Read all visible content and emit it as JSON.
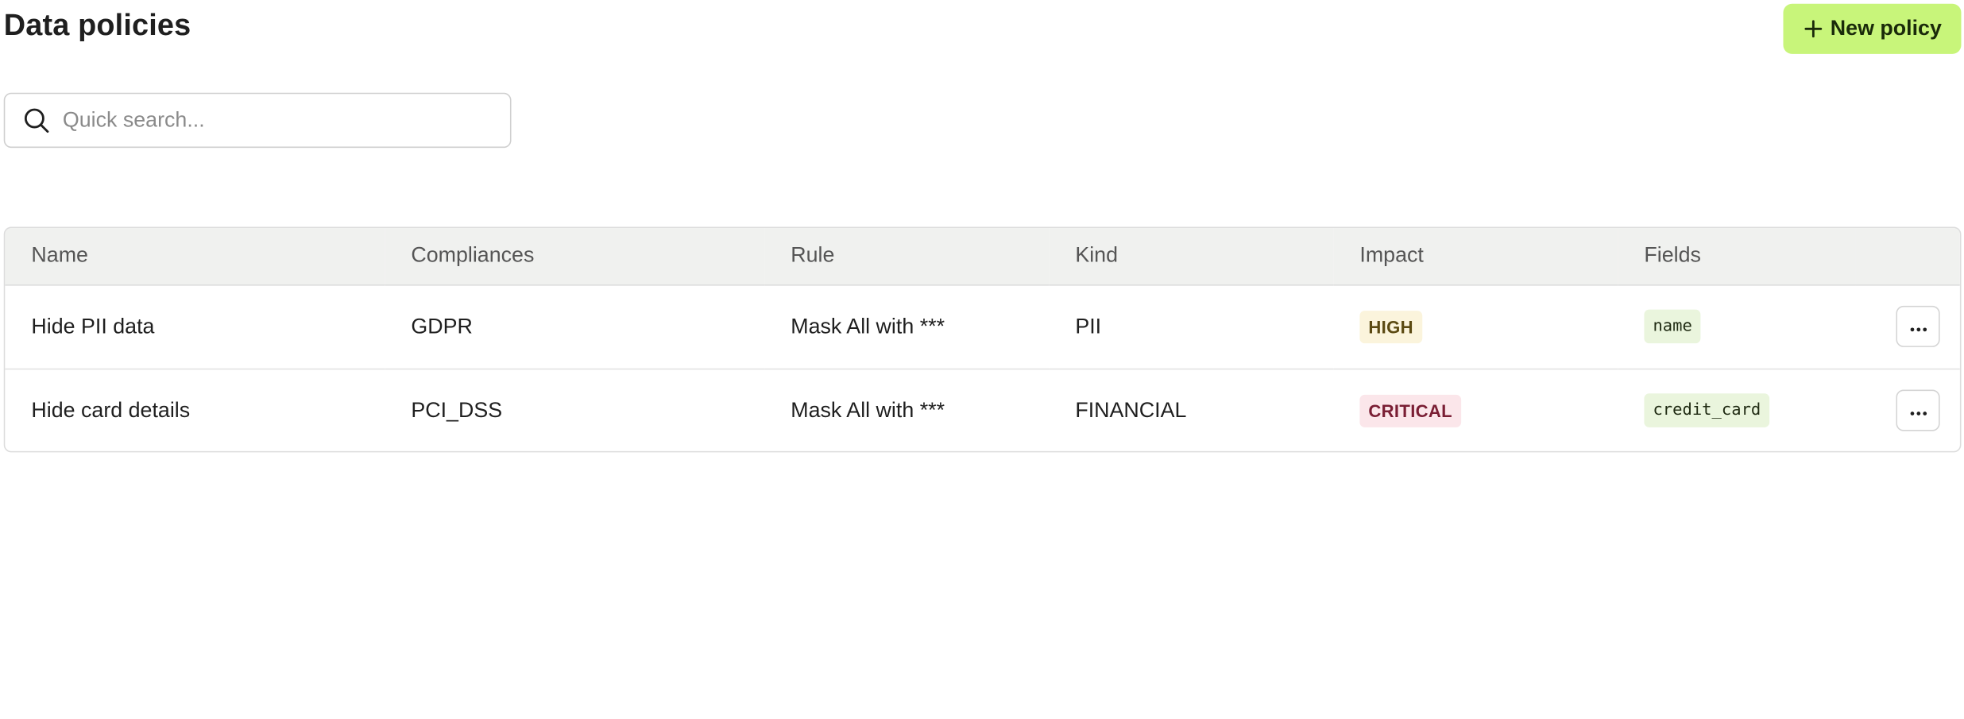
{
  "header": {
    "title": "Data policies",
    "new_policy_label": "New policy"
  },
  "search": {
    "placeholder": "Quick search...",
    "value": ""
  },
  "table": {
    "columns": [
      "Name",
      "Compliances",
      "Rule",
      "Kind",
      "Impact",
      "Fields"
    ],
    "rows": [
      {
        "name": "Hide PII data",
        "compliances": "GDPR",
        "rule": "Mask All with ***",
        "kind": "PII",
        "impact": "HIGH",
        "fields": "name"
      },
      {
        "name": "Hide card details",
        "compliances": "PCI_DSS",
        "rule": "Mask All with ***",
        "kind": "FINANCIAL",
        "impact": "CRITICAL",
        "fields": "credit_card"
      }
    ]
  },
  "colors": {
    "accent": "#c8f57a",
    "impact_high_bg": "#fbf4dc",
    "impact_critical_bg": "#fbe6ea",
    "field_chip_bg": "#eaf5dd",
    "header_row_bg": "#f0f1ef"
  },
  "icons": {
    "new_policy": "plus-icon",
    "search": "search-icon",
    "row_actions": "more-horizontal-icon"
  }
}
